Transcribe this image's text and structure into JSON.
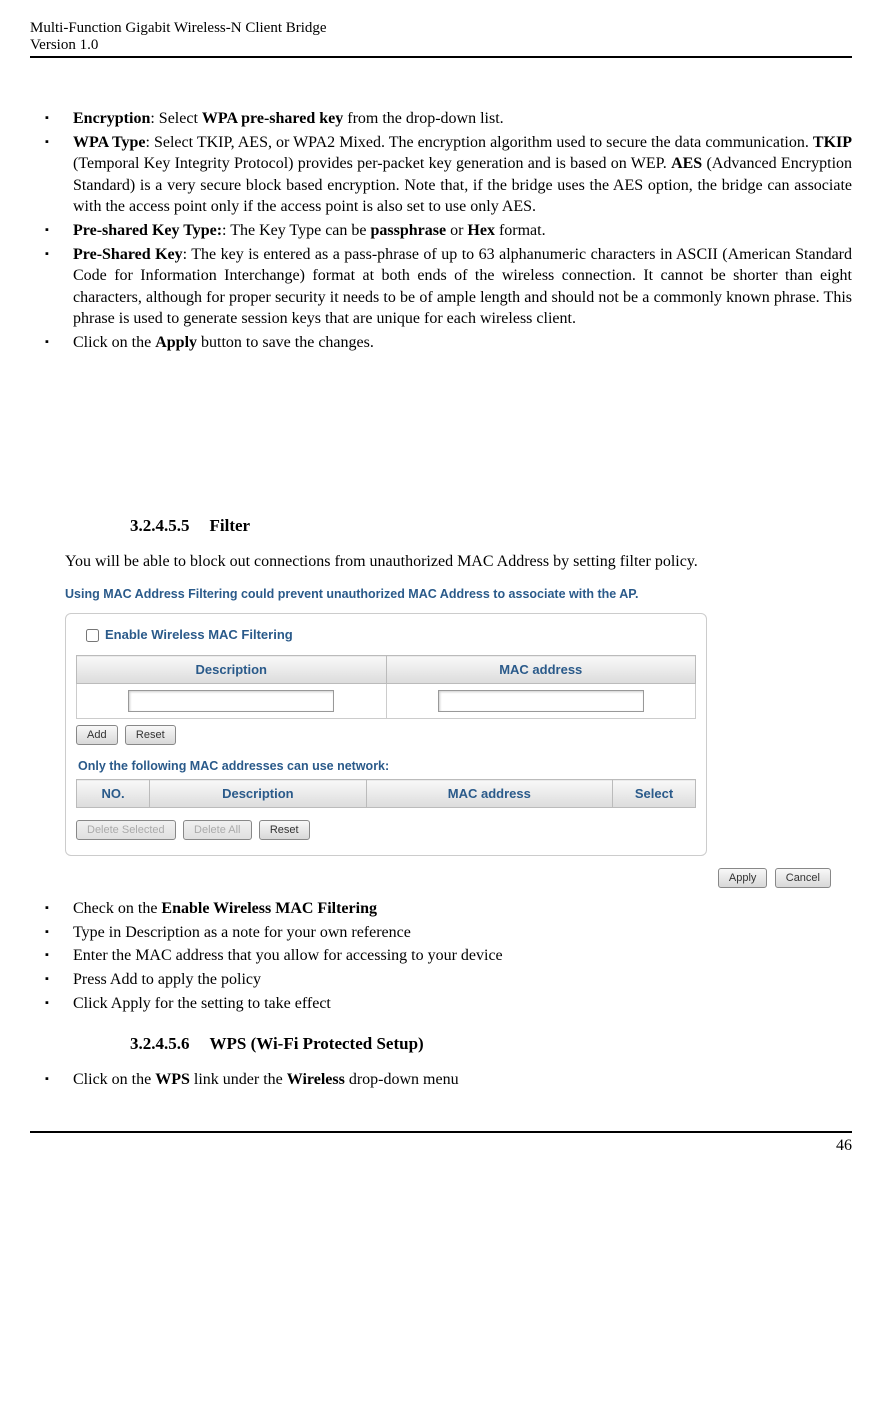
{
  "header": {
    "line1": "Multi-Function Gigabit Wireless-N Client Bridge",
    "line2": "Version 1.0"
  },
  "list1": {
    "i0": {
      "t1": "Encryption",
      "t2": ": Select ",
      "t3": "WPA pre-shared key",
      "t4": " from the drop-down list."
    },
    "i1": {
      "t1": "WPA Type",
      "t2": ": Select TKIP, AES, or WPA2 Mixed. The encryption algorithm used to secure the data communication. ",
      "t3": "TKIP",
      "t4": " (Temporal Key Integrity Protocol) provides per-packet key generation and is based on WEP. ",
      "t5": "AES",
      "t6": " (Advanced Encryption Standard) is a very secure block based encryption. Note that, if the bridge uses the AES option, the bridge can associate with the access point only if the access point is also set to use only AES."
    },
    "i2": {
      "t1": "Pre-shared Key Type:",
      "t2": ": The Key Type can be ",
      "t3": "passphrase",
      "t4": " or ",
      "t5": "Hex",
      "t6": " format."
    },
    "i3": {
      "t1": "Pre-Shared Key",
      "t2": ": The key is entered as a pass-phrase of up to 63 alphanumeric characters in ASCII (American Standard Code for Information Interchange) format at both ends of the wireless connection. It cannot be shorter than eight characters, although for proper security it needs to be of ample length and should not be a commonly known phrase. This phrase is used to generate session keys that are unique for each wireless client."
    },
    "i4": {
      "t1": "Click on the ",
      "t2": "Apply",
      "t3": " button to save the changes."
    }
  },
  "section1": {
    "num": "3.2.4.5.5",
    "title": "Filter"
  },
  "para1": "You will be able to block out connections from unauthorized MAC Address by setting filter policy.",
  "screenshot": {
    "caption": "Using MAC Address Filtering could prevent unauthorized MAC Address to associate with the AP.",
    "enable_label": "Enable Wireless MAC Filtering",
    "th_desc": "Description",
    "th_mac": "MAC address",
    "btn_add": "Add",
    "btn_reset1": "Reset",
    "sub_caption": "Only the following MAC addresses can use network:",
    "th2_no": "NO.",
    "th2_desc": "Description",
    "th2_mac": "MAC address",
    "th2_select": "Select",
    "btn_delsel": "Delete Selected",
    "btn_delall": "Delete All",
    "btn_reset2": "Reset",
    "btn_apply": "Apply",
    "btn_cancel": "Cancel"
  },
  "list2": {
    "i0": {
      "t1": "Check on the ",
      "t2": "Enable Wireless MAC Filtering"
    },
    "i1": "Type in Description as a note for your own reference",
    "i2": "Enter the MAC address that you allow for accessing to your device",
    "i3": "Press Add to apply the policy",
    "i4": "Click Apply for the setting to take effect"
  },
  "section2": {
    "num": "3.2.4.5.6",
    "title": "WPS (Wi-Fi Protected Setup)"
  },
  "list3": {
    "i0": {
      "t1": "Click on the ",
      "t2": "WPS",
      "t3": " link under the ",
      "t4": "Wireless",
      "t5": " drop-down menu"
    }
  },
  "page_number": "46"
}
